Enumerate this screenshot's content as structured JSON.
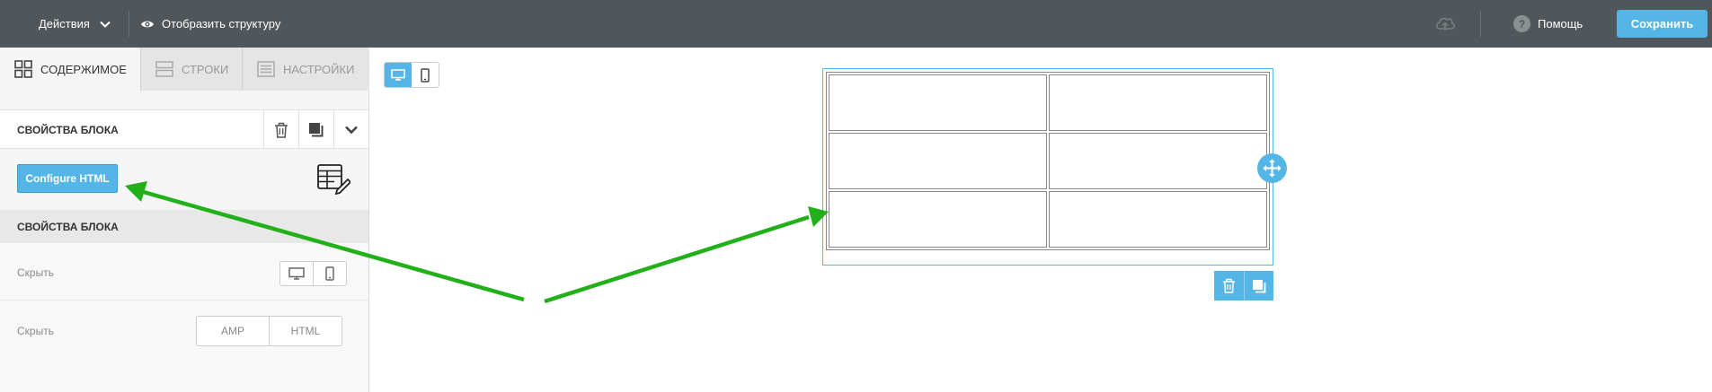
{
  "topbar": {
    "actions_label": "Действия",
    "structure_label": "Отобразить структуру",
    "help_label": "Помощь",
    "help_icon_glyph": "?",
    "save_label": "Сохранить"
  },
  "sidebar": {
    "tabs": [
      {
        "label": "СОДЕРЖИМОЕ",
        "icon": "grid-icon",
        "active": true
      },
      {
        "label": "СТРОКИ",
        "icon": "rows-icon",
        "active": false
      },
      {
        "label": "НАСТРОЙКИ",
        "icon": "settings-icon",
        "active": false
      }
    ],
    "block_header_title": "СВОЙСТВА БЛОКА",
    "configure_label": "Configure HTML",
    "section_title": "СВОЙСТВА БЛОКА",
    "hide_label_1": "Скрыть",
    "hide_label_2": "Скрыть",
    "type_options": [
      "AMP",
      "HTML"
    ]
  },
  "canvas": {
    "table_rows": 3,
    "table_cols": 2
  },
  "colors": {
    "topbar": "#505659",
    "accent": "#53b6e6",
    "arrow": "#22b01a"
  }
}
